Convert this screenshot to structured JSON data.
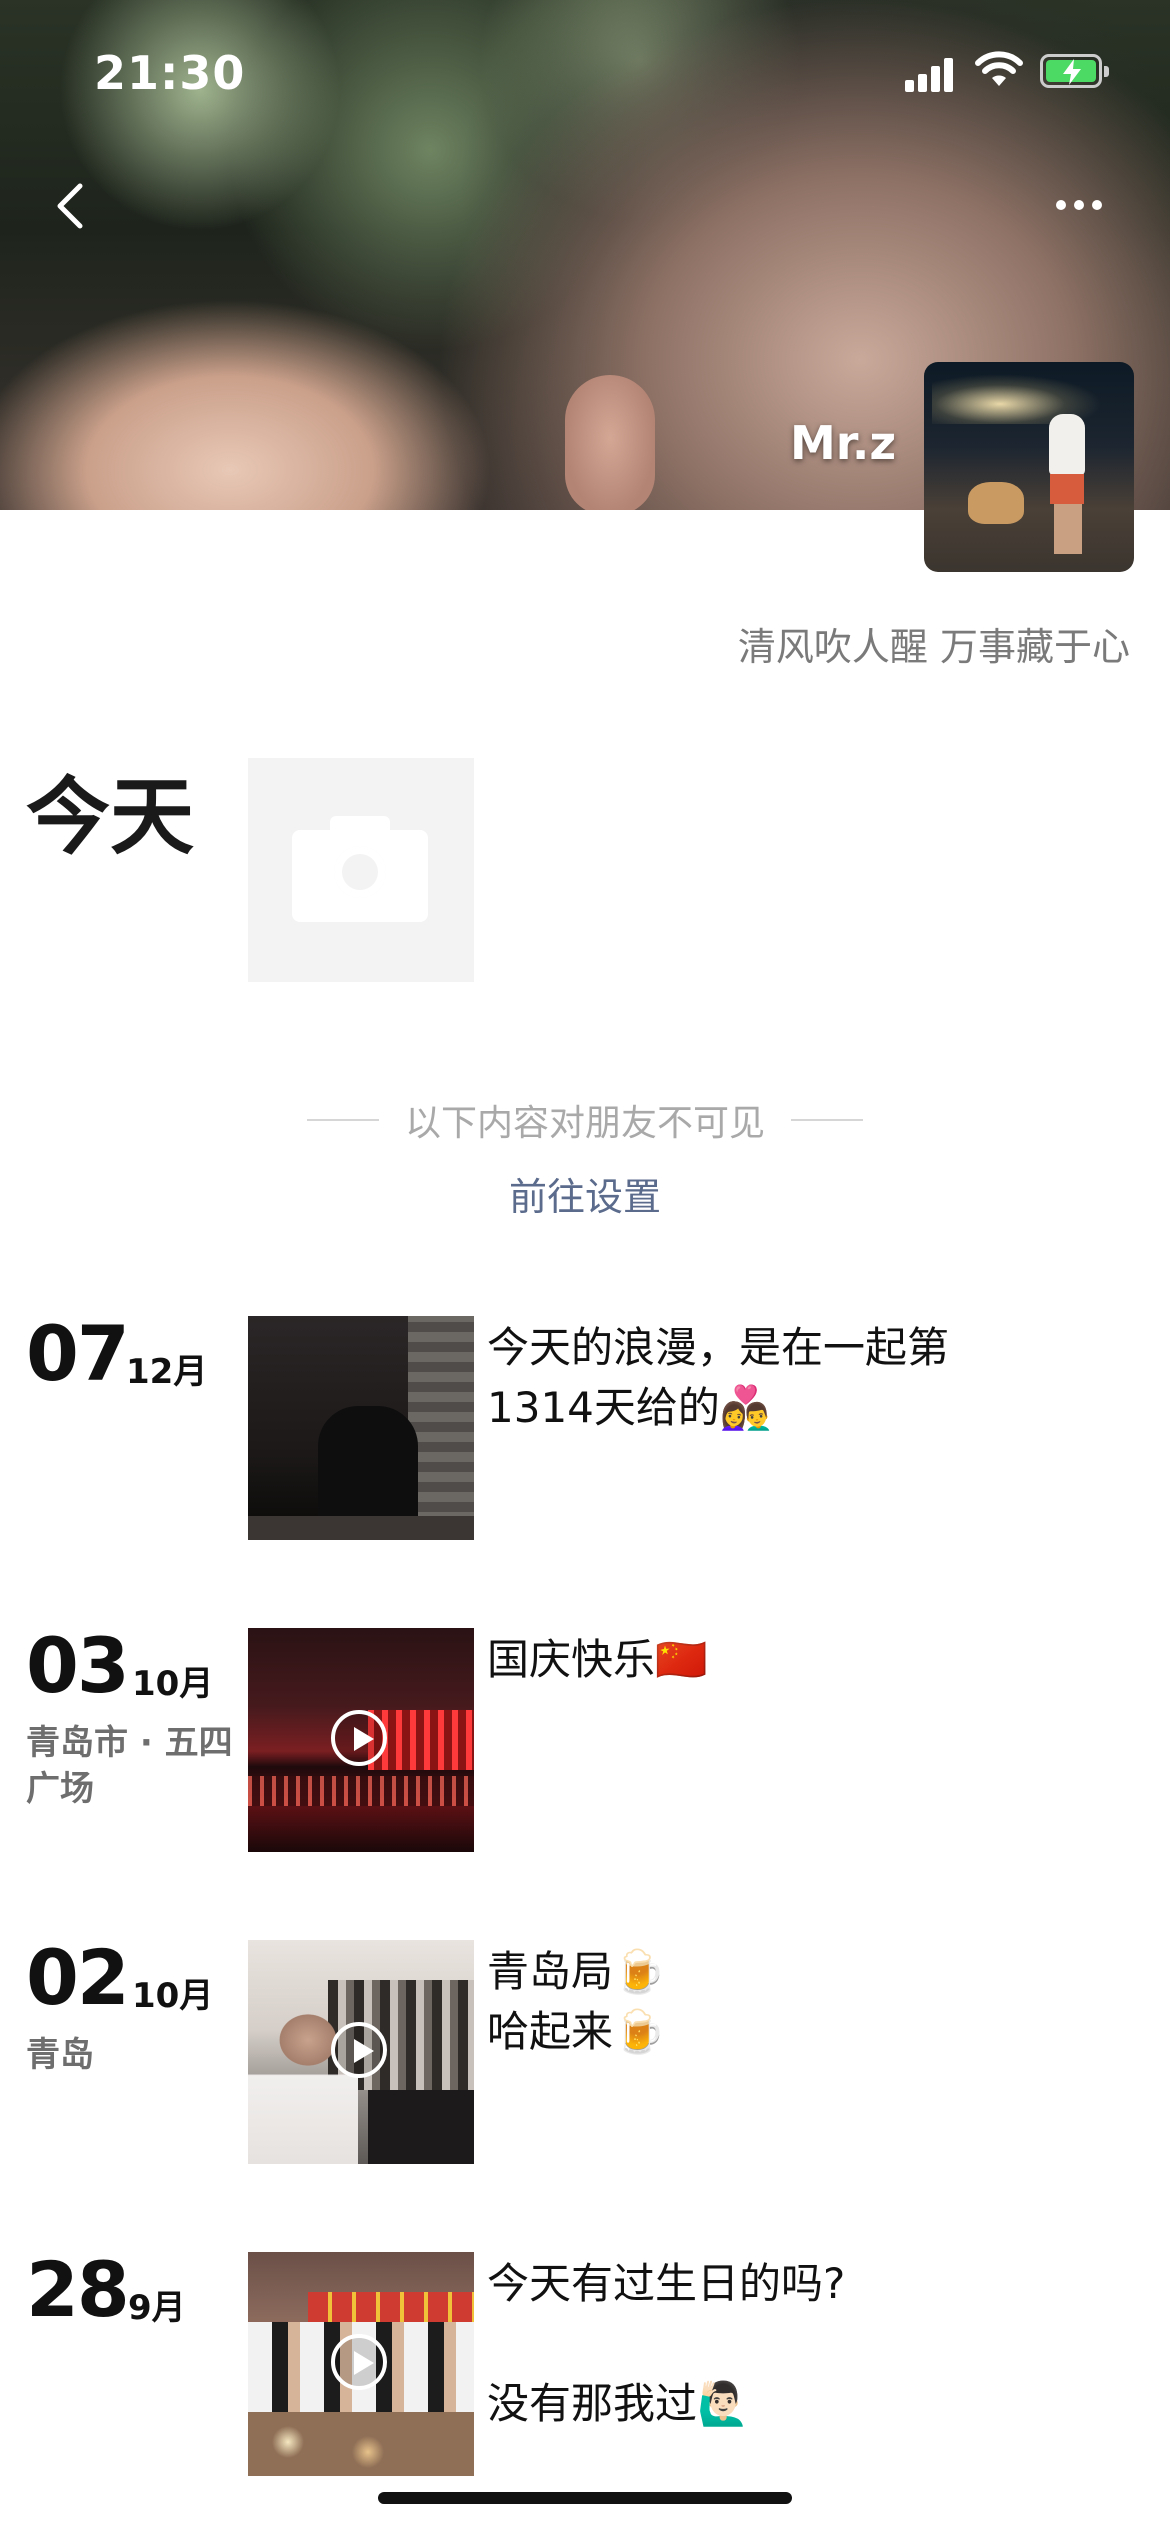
{
  "status_bar": {
    "time": "21:30"
  },
  "header": {
    "username": "Mr.z",
    "back_icon": "chevron-left-icon",
    "more_icon": "ellipsis-icon"
  },
  "profile": {
    "signature": "清风吹人醒 万事藏于心"
  },
  "today": {
    "label": "今天",
    "icon": "camera-icon"
  },
  "privacy": {
    "notice": "以下内容对朋友不可见",
    "link": "前往设置"
  },
  "posts": [
    {
      "day": "07",
      "month": "12月",
      "location": "",
      "text": "今天的浪漫，是在一起第1314天给的👩‍❤️‍👨",
      "is_video": false
    },
    {
      "day": "03",
      "month": "10月",
      "location": "青岛市 · 五四广场",
      "text": "国庆快乐🇨🇳",
      "is_video": true
    },
    {
      "day": "02",
      "month": "10月",
      "location": "青岛",
      "text": "青岛局🍺\n哈起来🍺",
      "is_video": true
    },
    {
      "day": "28",
      "month": "9月",
      "location": "",
      "text": "今天有过生日的吗?\n\n没有那我过🙋🏻‍♂️",
      "is_video": true
    }
  ],
  "colors": {
    "link": "#5b6b8c",
    "muted": "#a9a9a9",
    "battery": "#4cd964"
  }
}
